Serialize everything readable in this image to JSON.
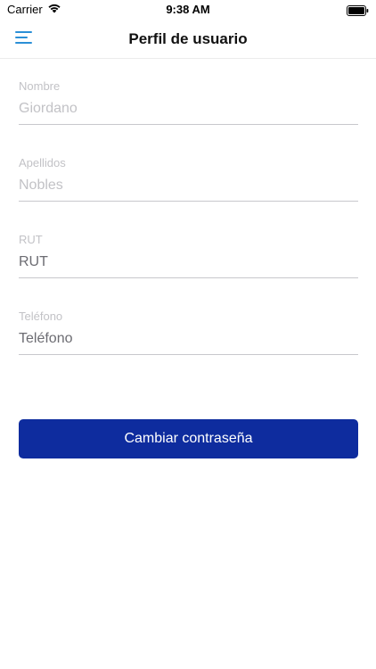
{
  "status_bar": {
    "carrier": "Carrier",
    "time": "9:38 AM"
  },
  "nav": {
    "title": "Perfil de usuario",
    "menu_icon": "hamburger-menu-icon",
    "accent_color": "#2b8fd6"
  },
  "form": {
    "nombre": {
      "label": "Nombre",
      "value": "Giordano",
      "placeholder": "Nombre"
    },
    "apellidos": {
      "label": "Apellidos",
      "value": "Nobles",
      "placeholder": "Apellidos"
    },
    "rut": {
      "label": "RUT",
      "value": "",
      "placeholder": "RUT"
    },
    "telefono": {
      "label": "Teléfono",
      "value": "",
      "placeholder": "Teléfono"
    }
  },
  "actions": {
    "change_password_label": "Cambiar contraseña",
    "button_color": "#0e2c9e"
  }
}
